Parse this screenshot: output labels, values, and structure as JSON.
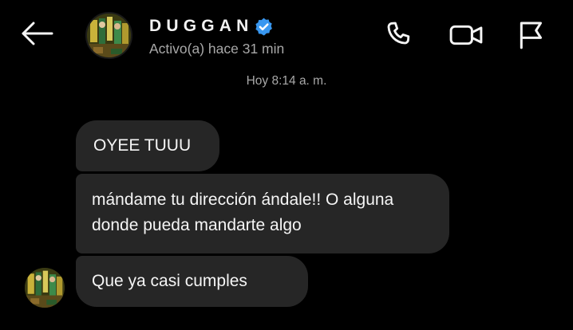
{
  "header": {
    "name": "DUGGAN",
    "status": "Activo(a) hace 31 min",
    "icons": {
      "back": "arrow-left-icon",
      "verified": "verified-badge-icon",
      "call": "phone-icon",
      "video": "video-camera-icon",
      "report": "flag-icon"
    }
  },
  "conversation": {
    "timestamp": "Hoy 8:14 a. m.",
    "messages": [
      {
        "text": "OYEE TUUU"
      },
      {
        "text": "mándame tu dirección ándale!! O alguna donde pueda mandarte algo"
      },
      {
        "text": "Que ya casi cumples"
      }
    ]
  },
  "colors": {
    "background": "#000000",
    "bubble": "#262626",
    "text": "#f5f5f5",
    "muted": "#a8a8a8",
    "verified": "#3897f0"
  }
}
